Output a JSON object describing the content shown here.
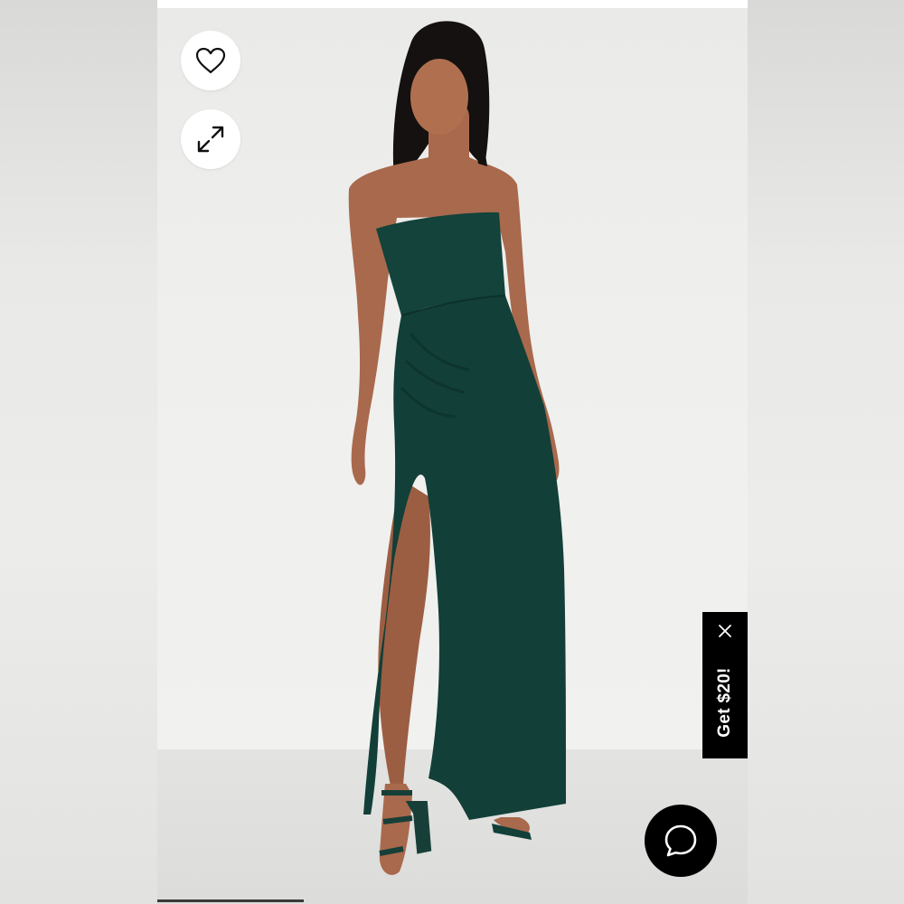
{
  "product_viewer": {
    "image_description_icon": "dress-photo",
    "wishlist_icon": "heart-icon",
    "expand_icon": "expand-icon"
  },
  "promo": {
    "label": "Get $20!",
    "close_icon": "close-icon"
  },
  "chat": {
    "icon": "chat-bubble-icon"
  },
  "colors": {
    "dress": "#123f38",
    "promo_bg": "#000000",
    "chat_bg": "#000000",
    "button_bg": "#ffffff"
  }
}
